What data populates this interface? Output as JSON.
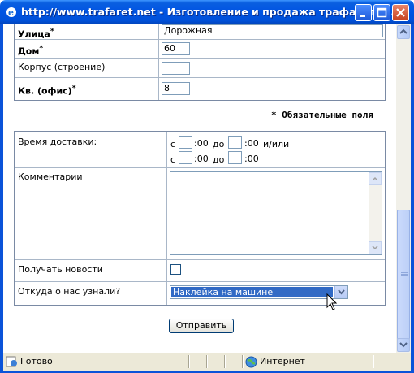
{
  "window": {
    "title": "http://www.trafaret.net - Изготовление и продажа трафарето...",
    "buttons": [
      "minimize",
      "maximize",
      "close"
    ]
  },
  "address_form": {
    "street": {
      "label": "Улица",
      "required_mark": "*",
      "value": "Дорожная"
    },
    "house": {
      "label": "Дом",
      "required_mark": "*",
      "value": "60"
    },
    "building": {
      "label": "Корпус (строение)",
      "value": ""
    },
    "apartment": {
      "label": "Кв. (офис)",
      "required_mark": "*",
      "value": "8"
    }
  },
  "required_note": "* Обязательные поля",
  "delivery": {
    "label": "Время доставки:",
    "from": "с",
    "to": "до",
    "minutes": ":00",
    "andor": "и/или",
    "hour1_from": "",
    "hour1_to": "",
    "hour2_from": "",
    "hour2_to": ""
  },
  "comments": {
    "label": "Комментарии",
    "value": ""
  },
  "news": {
    "label": "Получать новости",
    "checked": false
  },
  "source": {
    "label": "Откуда о нас узнали?",
    "selected": "Наклейка на машине"
  },
  "submit_label": "Отправить",
  "status": {
    "left": "Готово",
    "zone": "Интернет"
  }
}
